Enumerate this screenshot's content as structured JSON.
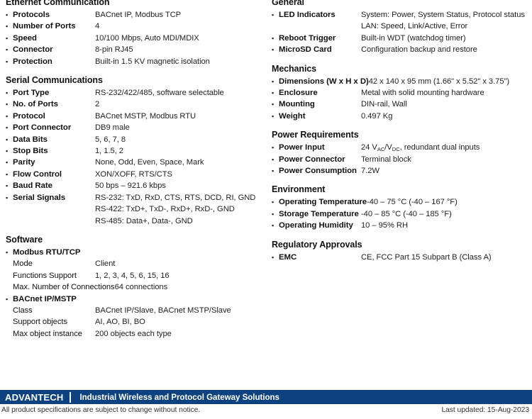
{
  "document": {
    "type": "product-datasheet-specifications"
  },
  "left_column": {
    "sections": [
      {
        "title": "Ethernet Communication",
        "rows": [
          {
            "label": "Protocols",
            "value": "BACnet IP, Modbus TCP"
          },
          {
            "label": "Number of Ports",
            "value": "4"
          },
          {
            "label": "Speed",
            "value": "10/100 Mbps, Auto MDI/MDIX"
          },
          {
            "label": "Connector",
            "value": "8-pin RJ45"
          },
          {
            "label": "Protection",
            "value": "Built-in 1.5 KV magnetic isolation"
          }
        ]
      },
      {
        "title": "Serial Communications",
        "rows": [
          {
            "label": "Port Type",
            "value": "RS-232/422/485, software selectable"
          },
          {
            "label": "No. of Ports",
            "value": "2"
          },
          {
            "label": "Protocol",
            "value": "BACnet MSTP, Modbus RTU"
          },
          {
            "label": "Port Connector",
            "value": "DB9 male"
          },
          {
            "label": "Data Bits",
            "value": "5, 6, 7, 8"
          },
          {
            "label": "Stop Bits",
            "value": "1, 1.5, 2"
          },
          {
            "label": "Parity",
            "value": "None, Odd, Even, Space, Mark"
          },
          {
            "label": "Flow Control",
            "value": "XON/XOFF, RTS/CTS"
          },
          {
            "label": "Baud Rate",
            "value": "50 bps – 921.6 kbps"
          },
          {
            "label": "Serial Signals",
            "value": "RS-232: TxD, RxD, CTS, RTS, DCD, RI, GND\nRS-422: TxD+, TxD-, RxD+, RxD-, GND\nRS-485: Data+, Data-, GND"
          }
        ]
      },
      {
        "title": "Software",
        "rows": [
          {
            "label": "Modbus RTU/TCP",
            "value": ""
          },
          {
            "label": "Mode",
            "value": "Client",
            "sub": true
          },
          {
            "label": "Functions Support",
            "value": "1, 2, 3, 4, 5, 6, 15, 16",
            "sub": true
          },
          {
            "label": "Max. Number of Connections",
            "value": "64 connections",
            "sub": true
          },
          {
            "label": "BACnet IP/MSTP",
            "value": ""
          },
          {
            "label": "Class",
            "value": "BACnet IP/Slave, BACnet MSTP/Slave",
            "sub": true
          },
          {
            "label": "Support objects",
            "value": "AI, AO, BI, BO",
            "sub": true
          },
          {
            "label": "Max object instance",
            "value": "200 objects each type",
            "sub": true
          }
        ]
      }
    ]
  },
  "right_column": {
    "sections": [
      {
        "title": "General",
        "rows": [
          {
            "label": "LED Indicators",
            "value": "System: Power, System Status, Protocol status\nLAN: Speed, Link/Active, Error"
          },
          {
            "label": "Reboot Trigger",
            "value": "Built-in WDT (watchdog timer)"
          },
          {
            "label": "MicroSD Card",
            "value": "Configuration backup and restore"
          }
        ]
      },
      {
        "title": "Mechanics",
        "rows": [
          {
            "label": "Dimensions (W x H x D)",
            "value": "42 x 140 x 95 mm (1.66\" x 5.52\" x 3.75\")"
          },
          {
            "label": "Enclosure",
            "value": "Metal with solid mounting hardware"
          },
          {
            "label": "Mounting",
            "value": "DIN-rail, Wall"
          },
          {
            "label": "Weight",
            "value": "0.497 Kg"
          }
        ]
      },
      {
        "title": "Power Requirements",
        "rows": [
          {
            "label": "Power Input",
            "value": "24 VAC/VDC, redundant dual inputs",
            "html": "24 V<sub>AC</sub>/V<sub>DC</sub>, redundant dual inputs"
          },
          {
            "label": "Power Connector",
            "value": "Terminal block"
          },
          {
            "label": "Power Consumption",
            "value": "7.2W"
          }
        ]
      },
      {
        "title": "Environment",
        "rows": [
          {
            "label": "Operating Temperature",
            "value": "-40 – 75 °C (-40 – 167 °F)"
          },
          {
            "label": "Storage Temperature",
            "value": "-40 – 85 °C (-40 – 185 °F)"
          },
          {
            "label": "Operating Humidity",
            "value": "10 – 95% RH"
          }
        ]
      },
      {
        "title": "Regulatory Approvals",
        "rows": [
          {
            "label": "EMC",
            "value": "CE, FCC Part 15 Subpart B (Class A)"
          }
        ]
      }
    ]
  },
  "footer": {
    "brand": "ADVANTECH",
    "tagline": "Industrial Wireless and Protocol Gateway Solutions",
    "disclaimer": "All product specifications are subject to change without notice.",
    "last_updated": "Last updated: 15-Aug-2023",
    "banner_color": "#0d4280"
  }
}
